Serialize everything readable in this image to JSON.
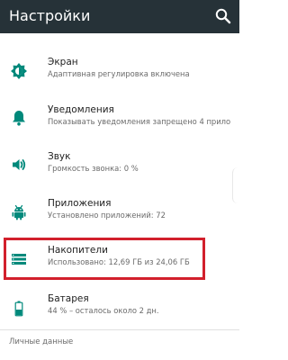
{
  "app": {
    "title": "Настройки"
  },
  "colors": {
    "appbar": "#263238",
    "icon": "#00897b",
    "highlight": "#d2202c"
  },
  "settings": [
    {
      "label": "Экран",
      "sub": "Адаптивная регулировка включена",
      "icon": "brightness-icon"
    },
    {
      "label": "Уведомления",
      "sub": "Показывать уведомления запрещено 4 прило",
      "icon": "bell-icon"
    },
    {
      "label": "Звук",
      "sub": "Громкость звонка: 0 %",
      "icon": "speaker-icon"
    },
    {
      "label": "Приложения",
      "sub": "Установлено приложений: 72",
      "icon": "android-icon"
    },
    {
      "label": "Накопители",
      "sub": "Использовано: 12,69 ГБ из 24,06 ГБ",
      "icon": "storage-icon"
    },
    {
      "label": "Батарея",
      "sub": "44 % – осталось около 2 дн.",
      "icon": "battery-icon"
    }
  ],
  "section_header": "Личные данные"
}
